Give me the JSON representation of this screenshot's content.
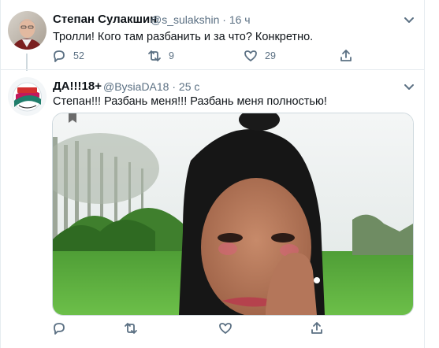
{
  "tweet1": {
    "display_name": "Степан Сулакшин",
    "handle": "@s_sulakshin",
    "separator": "·",
    "time": "16 ч",
    "text": "Тролли! Кого там  разбанить и за что? Конкретно.",
    "replies": "52",
    "retweets": "9",
    "likes": "29"
  },
  "tweet2": {
    "display_name": "ДА!!!18+",
    "handle": "@BysiaDA18",
    "separator": "·",
    "time": "25 с",
    "text": "Степан!!! Разбань меня!!! Разбань меня полностью!"
  },
  "colors": {
    "secondary_text": "#5b7083",
    "divider": "#e6ecf0",
    "grass": "#5dae3f"
  },
  "icons": [
    "reply-icon",
    "retweet-icon",
    "like-icon",
    "share-icon",
    "chevron-down-icon",
    "bookmark-icon"
  ]
}
